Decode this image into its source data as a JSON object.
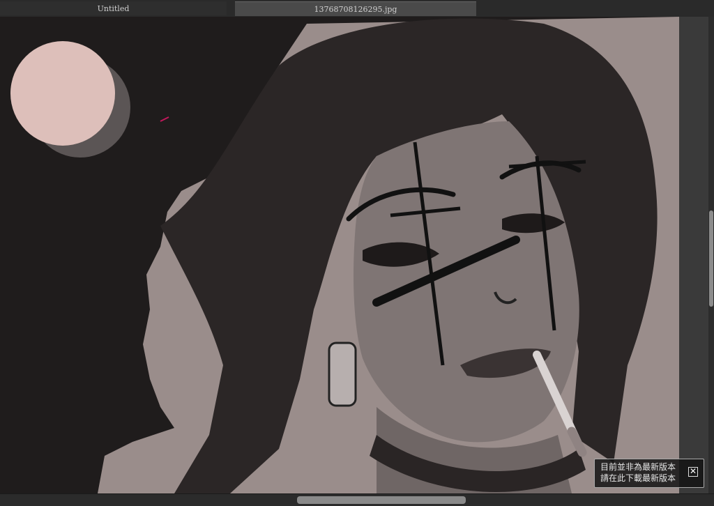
{
  "tabs": [
    {
      "label": "Untitled",
      "active": false
    },
    {
      "label": "1376870812629​5.jpg",
      "active": true
    }
  ],
  "notification": {
    "line1": "目前並非為最新版本",
    "line2": "請在此下載最新版本",
    "close_icon": "close-box-icon"
  },
  "colors": {
    "background": "#1f1c1c",
    "flat_fill": "#9a8d8b",
    "swatch_pink": "#ddbfba",
    "swatch_shadow": "#5b5555"
  }
}
